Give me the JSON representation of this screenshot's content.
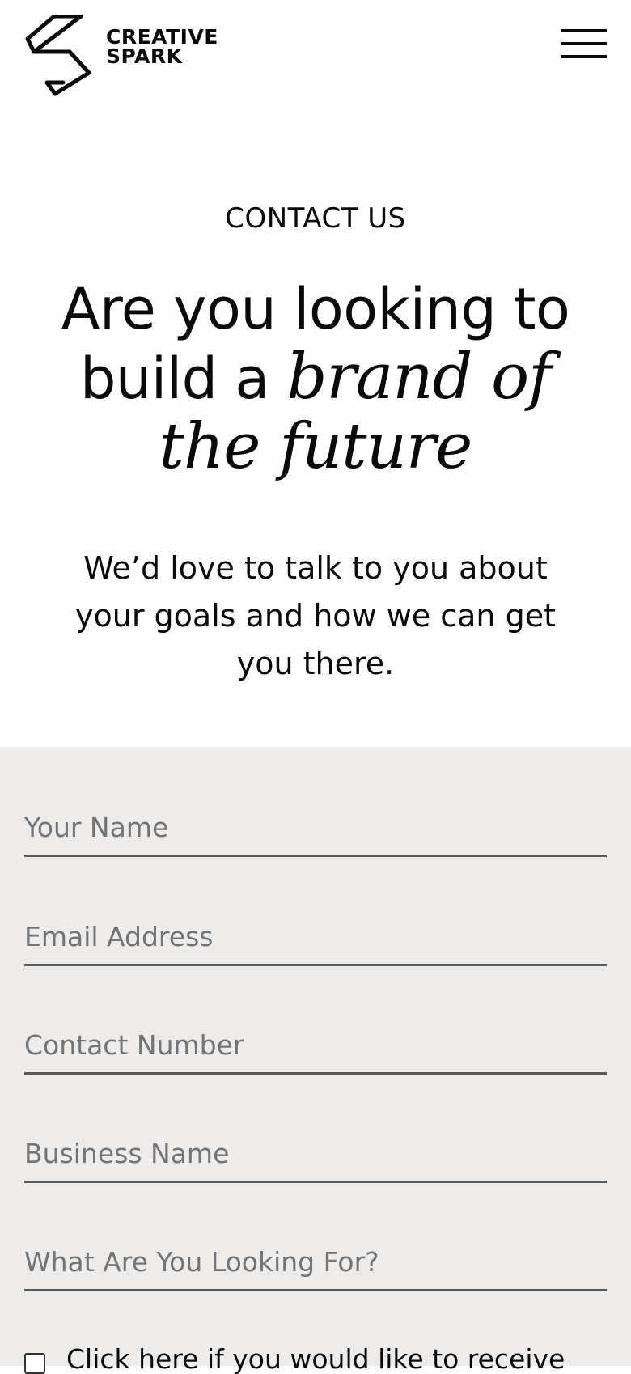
{
  "header": {
    "logo_line1": "CREATIVE",
    "logo_line2": "SPARK",
    "menu_icon": "hamburger-menu-icon"
  },
  "hero": {
    "eyebrow": "CONTACT US",
    "headline_line1": "Are you looking to",
    "headline_line2_plain": "build a ",
    "headline_line2_italic": "brand of",
    "headline_line3_italic": "the future",
    "lede_line1": "We’d love to talk to you about",
    "lede_line2": "your goals and how we can get",
    "lede_line3": "you there."
  },
  "form": {
    "name_placeholder": "Your Name",
    "email_placeholder": "Email Address",
    "phone_placeholder": "Contact Number",
    "business_placeholder": "Business Name",
    "looking_for_placeholder": "What Are You Looking For?",
    "consent_label": "Click here if you would like to receive"
  },
  "colors": {
    "text": "#0a0a0a",
    "form_background": "#edecea",
    "placeholder": "#747474",
    "field_underline": "#5a5a5a"
  }
}
